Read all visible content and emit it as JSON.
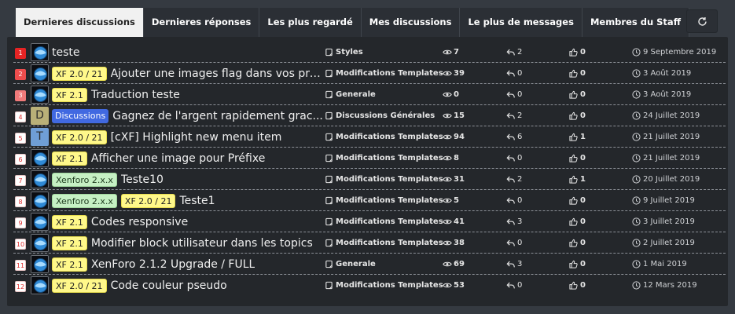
{
  "tabs": [
    {
      "label": "Dernieres discussions",
      "active": true
    },
    {
      "label": "Dernieres réponses",
      "active": false
    },
    {
      "label": "Les plus regardé",
      "active": false
    },
    {
      "label": "Mes discussions",
      "active": false
    },
    {
      "label": "Le plus de messages",
      "active": false
    },
    {
      "label": "Membres du Staff",
      "active": false
    }
  ],
  "refresh_icon": "refresh-icon",
  "colors": {
    "background": "#353a41",
    "panel": "#24272b",
    "prefix_yellow": "#fff88a",
    "prefix_green": "#c6f0c4",
    "prefix_blue": "#4169e1",
    "rank_red": "#e62424"
  },
  "rows": [
    {
      "rank": "1",
      "avatar": "",
      "prefixes": [],
      "title": "teste",
      "category": "Styles",
      "views": "7",
      "replies": "2",
      "likes": "0",
      "date": "9 Septembre 2019"
    },
    {
      "rank": "2",
      "avatar": "",
      "prefixes": [
        {
          "text": "XF 2.0 / 21",
          "style": "yellow"
        }
      ],
      "title": "Ajouter une images flag dans vos pre...",
      "category": "Modifications Templates",
      "views": "39",
      "replies": "0",
      "likes": "0",
      "date": "3 Août 2019"
    },
    {
      "rank": "3",
      "avatar": "",
      "prefixes": [
        {
          "text": "XF 2.1",
          "style": "yellow"
        }
      ],
      "title": "Traduction teste",
      "category": "Generale",
      "views": "0",
      "replies": "0",
      "likes": "0",
      "date": "3 Août 2019"
    },
    {
      "rank": "4",
      "avatar": "D",
      "prefixes": [
        {
          "text": "Discussions",
          "style": "blue"
        }
      ],
      "title": "Gagnez de l'argent rapidement grac...",
      "category": "Discussions Générales",
      "views": "15",
      "replies": "2",
      "likes": "0",
      "date": "24 Juillet 2019"
    },
    {
      "rank": "5",
      "avatar": "T",
      "prefixes": [
        {
          "text": "XF 2.0 / 21",
          "style": "yellow"
        }
      ],
      "title": "[cXF] Highlight new menu item",
      "category": "Modifications Templates",
      "views": "94",
      "replies": "6",
      "likes": "1",
      "date": "21 Juillet 2019"
    },
    {
      "rank": "6",
      "avatar": "",
      "prefixes": [
        {
          "text": "XF 2.1",
          "style": "yellow"
        }
      ],
      "title": "Afficher une image pour Préfixe",
      "category": "Modifications Templates",
      "views": "8",
      "replies": "0",
      "likes": "0",
      "date": "21 Juillet 2019"
    },
    {
      "rank": "7",
      "avatar": "",
      "prefixes": [
        {
          "text": "Xenforo 2.x.x",
          "style": "green"
        }
      ],
      "title": "Teste10",
      "category": "Modifications Templates",
      "views": "31",
      "replies": "2",
      "likes": "1",
      "date": "20 Juillet 2019"
    },
    {
      "rank": "8",
      "avatar": "",
      "prefixes": [
        {
          "text": "Xenforo 2.x.x",
          "style": "green"
        },
        {
          "text": "XF 2.0 / 21",
          "style": "yellow"
        }
      ],
      "title": "Teste1",
      "category": "Modifications Templates",
      "views": "5",
      "replies": "0",
      "likes": "0",
      "date": "9 Juillet 2019"
    },
    {
      "rank": "9",
      "avatar": "",
      "prefixes": [
        {
          "text": "XF 2.1",
          "style": "yellow"
        }
      ],
      "title": "Codes responsive",
      "category": "Modifications Templates",
      "views": "41",
      "replies": "3",
      "likes": "0",
      "date": "3 Juillet 2019"
    },
    {
      "rank": "10",
      "avatar": "",
      "prefixes": [
        {
          "text": "XF 2.1",
          "style": "yellow"
        }
      ],
      "title": "Modifier block utilisateur dans les topics",
      "category": "Modifications Templates",
      "views": "38",
      "replies": "0",
      "likes": "0",
      "date": "2 Juillet 2019"
    },
    {
      "rank": "11",
      "avatar": "",
      "prefixes": [
        {
          "text": "XF 2.1",
          "style": "yellow"
        }
      ],
      "title": "XenForo 2.1.2 Upgrade / FULL",
      "category": "Generale",
      "views": "69",
      "replies": "3",
      "likes": "0",
      "date": "1 Mai 2019"
    },
    {
      "rank": "12",
      "avatar": "",
      "prefixes": [
        {
          "text": "XF 2.0 / 21",
          "style": "yellow"
        }
      ],
      "title": "Code couleur pseudo",
      "category": "Modifications Templates",
      "views": "53",
      "replies": "0",
      "likes": "0",
      "date": "12 Mars 2019"
    }
  ]
}
